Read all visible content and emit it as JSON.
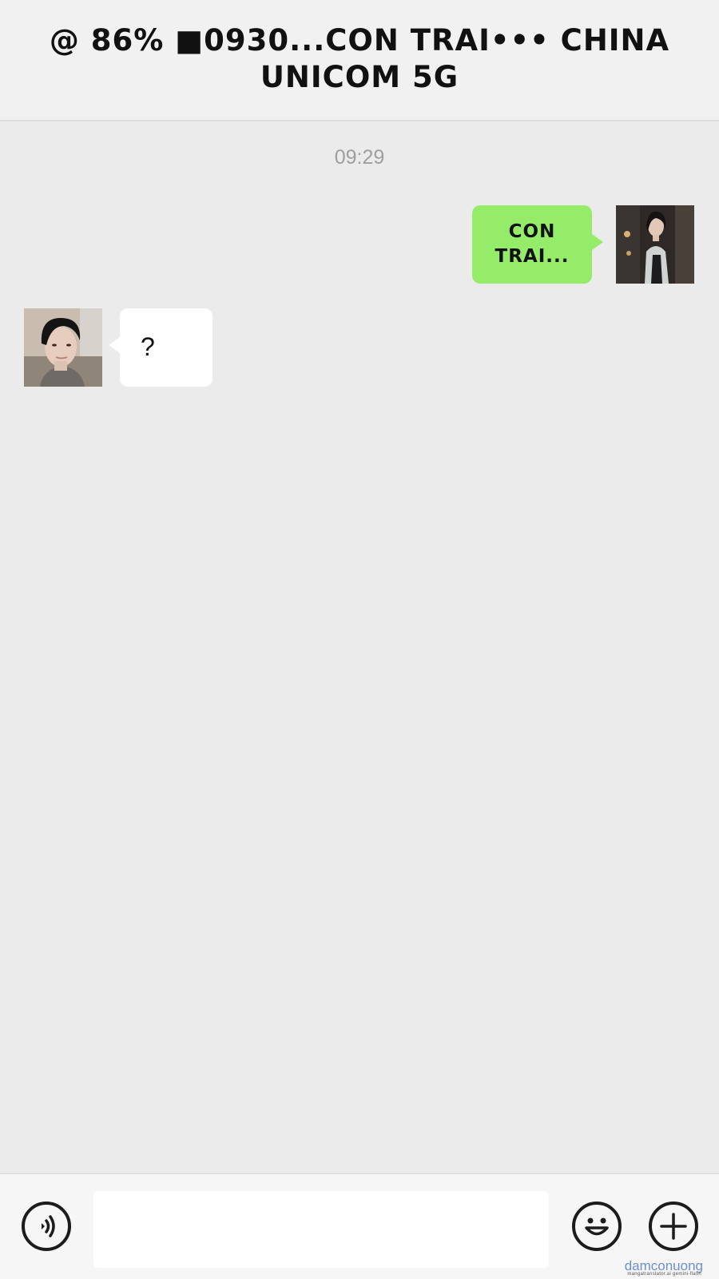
{
  "header": {
    "title": "@ 86% ■0930...CON TRAI••• CHINA UNICOM 5G"
  },
  "chat": {
    "timestamp": "09:29",
    "messages": [
      {
        "sender": "self",
        "text": "CON TRAI..."
      },
      {
        "sender": "contact",
        "text": "?"
      }
    ]
  },
  "input_bar": {
    "input_value": "",
    "icons": [
      "voice-icon",
      "emoji-icon",
      "plus-icon"
    ]
  },
  "watermark": {
    "main": "damconuong",
    "sub": "mangatranslator.ai   gemini-flash"
  },
  "colors": {
    "outgoing_bubble": "#95ec69",
    "incoming_bubble": "#ffffff",
    "chat_background": "#ebebeb"
  }
}
